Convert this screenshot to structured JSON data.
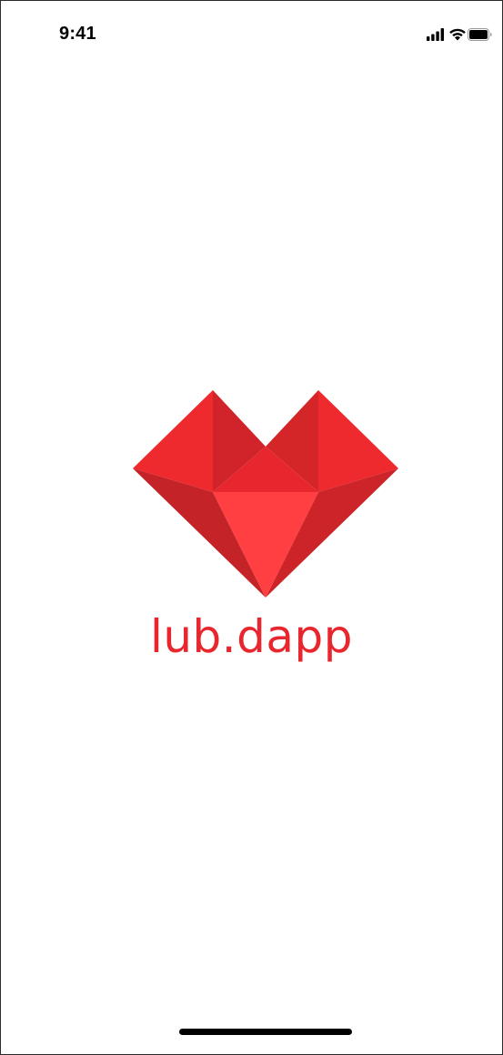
{
  "status_bar": {
    "time": "9:41",
    "icons": [
      "cellular-signal-icon",
      "wifi-icon",
      "battery-icon"
    ]
  },
  "splash": {
    "logo": "ruby-heart-logo",
    "brand_name": "lub.dapp"
  },
  "colors": {
    "brand_red": "#e8262e",
    "facet_dark": "#c8242a",
    "facet_mid": "#dc2a2e",
    "facet_light": "#ff4d4f",
    "background": "#ffffff"
  }
}
